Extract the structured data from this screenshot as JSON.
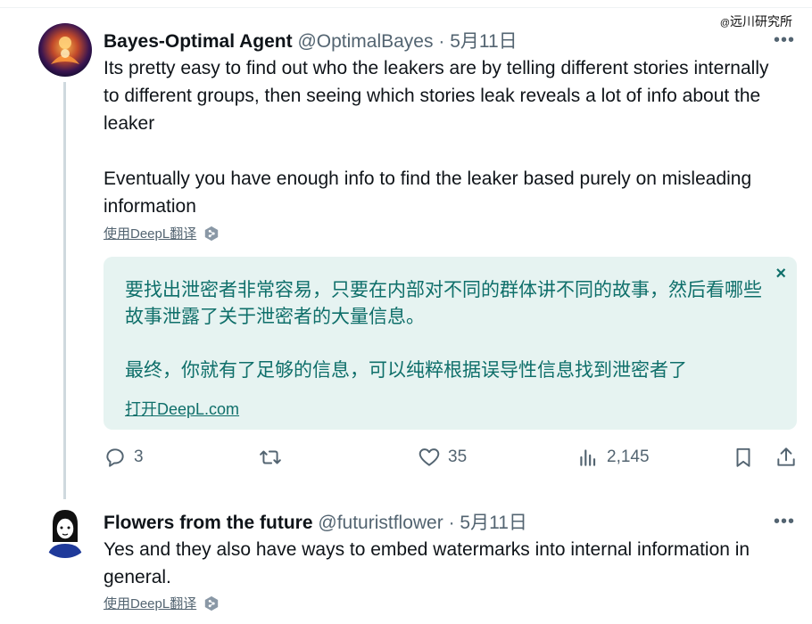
{
  "watermark": {
    "at": "@",
    "text": "远川研究所"
  },
  "tweet1": {
    "name": "Bayes-Optimal Agent",
    "handle": "@OptimalBayes",
    "sep": "·",
    "date": "5月11日",
    "more": "•••",
    "paragraph1": "Its pretty easy to find out who the leakers are by telling different stories internally to different groups, then seeing which stories leak reveals a lot of info about the leaker",
    "paragraph2": "Eventually you have enough info to find the leaker based purely on misleading information",
    "translate_label": "使用DeepL翻译",
    "translation": {
      "paragraph1": "要找出泄密者非常容易，只要在内部对不同的群体讲不同的故事，然后看哪些故事泄露了关于泄密者的大量信息。",
      "paragraph2": "最终，你就有了足够的信息，可以纯粹根据误导性信息找到泄密者了",
      "open_link": "打开DeepL.com",
      "close": "×"
    },
    "actions": {
      "replies": "3",
      "retweets": "",
      "likes": "35",
      "views": "2,145"
    }
  },
  "tweet2": {
    "name": "Flowers from the future",
    "handle": "@futuristflower",
    "sep": "·",
    "date": "5月11日",
    "more": "•••",
    "paragraph1": "Yes and they also have ways to embed watermarks into internal information in general.",
    "translate_label": "使用DeepL翻译"
  },
  "colors": {
    "accent": "#0f6f6a",
    "translation_bg": "#e6f3f1",
    "muted": "#536471"
  }
}
